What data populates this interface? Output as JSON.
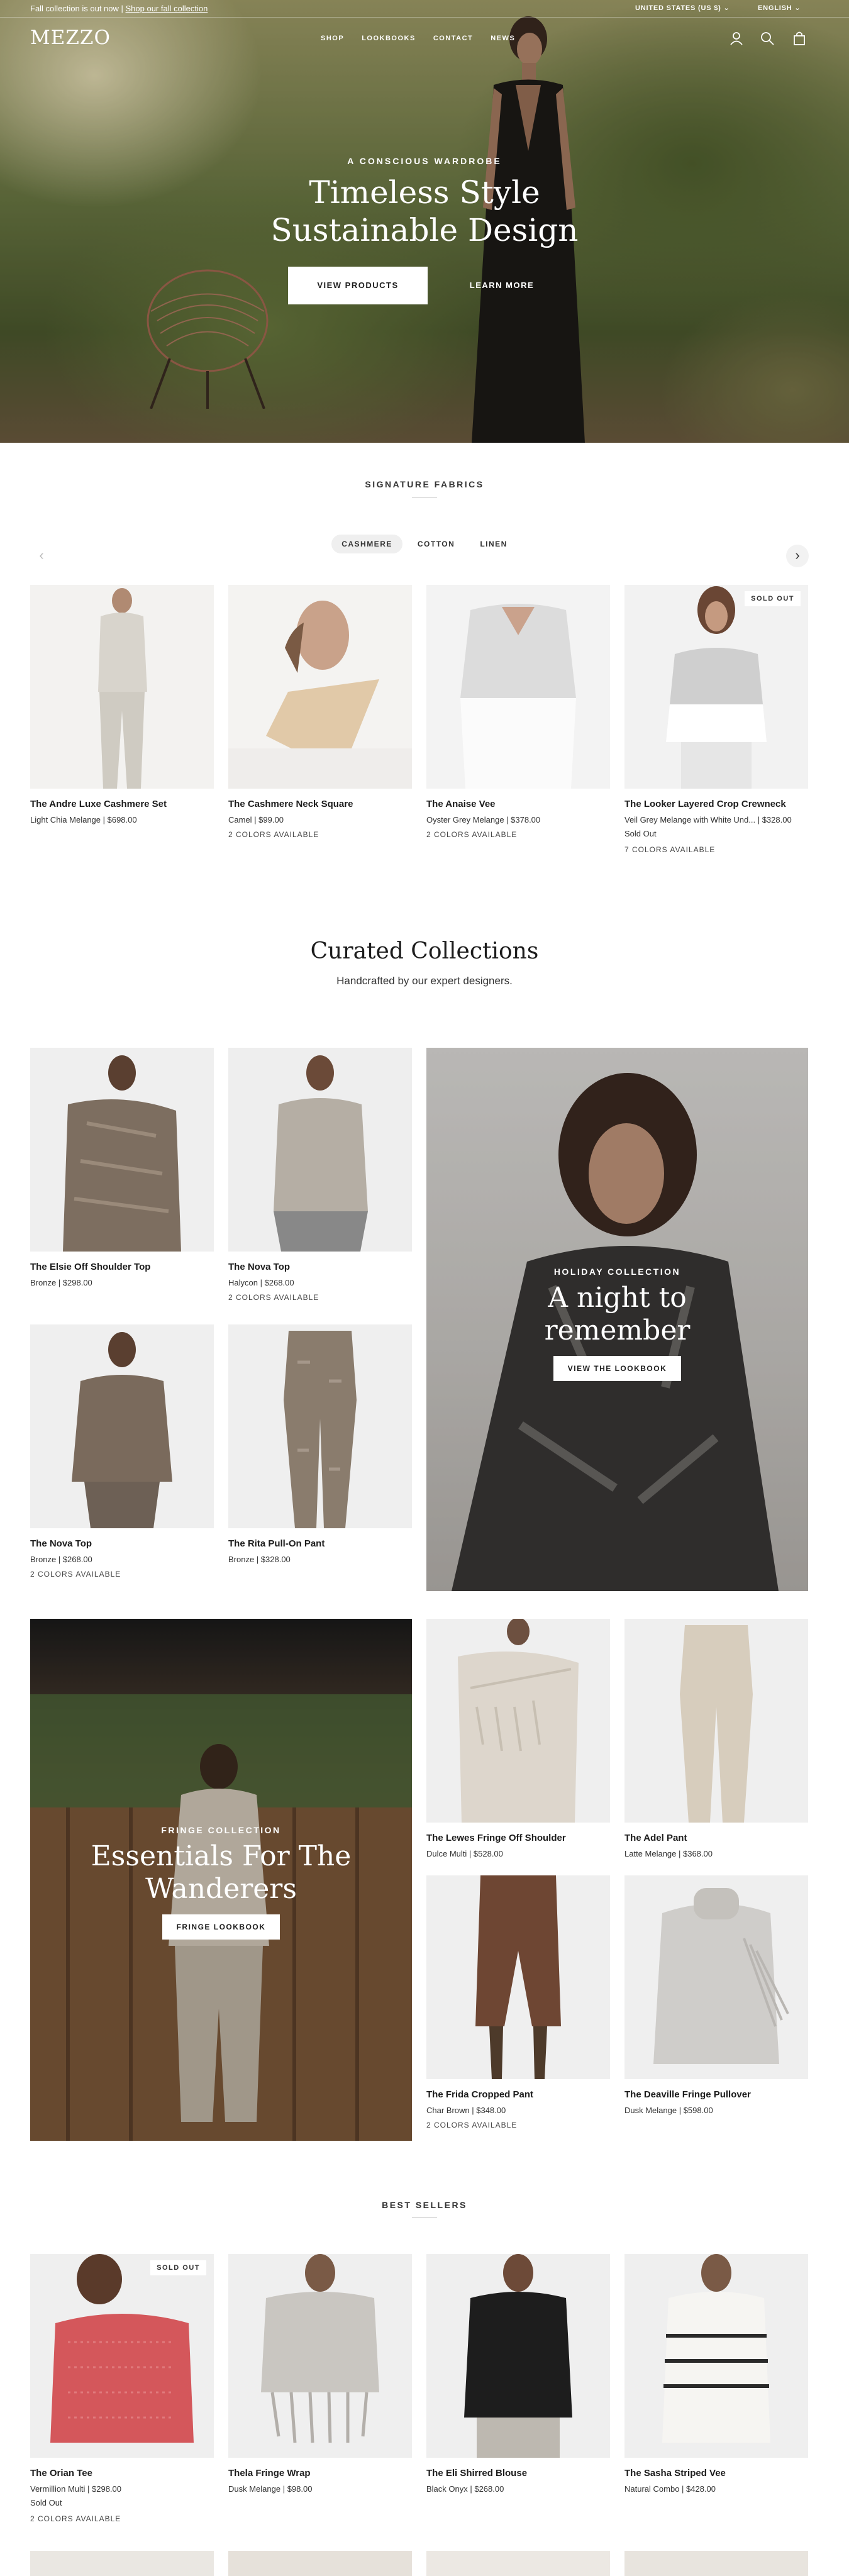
{
  "announcement": {
    "text": "Fall collection is out now | ",
    "link": "Shop our fall collection"
  },
  "selectors": {
    "country": "UNITED STATES (US $)",
    "language": "ENGLISH"
  },
  "brand": {
    "logo": "MEZZO"
  },
  "nav": {
    "items": [
      "SHOP",
      "LOOKBOOKS",
      "CONTACT",
      "NEWS"
    ],
    "icons": [
      "account-icon",
      "search-icon",
      "cart-icon"
    ]
  },
  "hero": {
    "kicker": "A CONSCIOUS WARDROBE",
    "title_line1": "Timeless Style",
    "title_line2": "Sustainable Design",
    "primary_button": "VIEW PRODUCTS",
    "secondary_button": "LEARN MORE"
  },
  "signature": {
    "title": "SIGNATURE FABRICS",
    "tabs": [
      "CASHMERE",
      "COTTON",
      "LINEN"
    ],
    "active_tab": "CASHMERE",
    "products": [
      {
        "name": "The Andre Luxe Cashmere Set",
        "price": "Light Chia Melange | $698.00",
        "colors": "",
        "sold_out": false
      },
      {
        "name": "The Cashmere Neck Square",
        "price": "Camel | $99.00",
        "colors": "2 COLORS AVAILABLE",
        "sold_out": false
      },
      {
        "name": "The Anaise Vee",
        "price": "Oyster Grey Melange | $378.00",
        "colors": "2 COLORS AVAILABLE",
        "sold_out": false
      },
      {
        "name": "The Looker Layered Crop Crewneck",
        "price": "Veil Grey Melange with White Und... | $328.00",
        "status": "Sold Out",
        "colors": "7 COLORS AVAILABLE",
        "sold_out": true,
        "badge": "SOLD OUT"
      }
    ]
  },
  "curated": {
    "title": "Curated Collections",
    "subtitle": "Handcrafted by our expert designers.",
    "products": [
      {
        "name": "The Elsie Off Shoulder Top",
        "price": "Bronze | $298.00",
        "colors": ""
      },
      {
        "name": "The Nova Top",
        "price": "Halycon | $268.00",
        "colors": "2 COLORS AVAILABLE"
      },
      {
        "name": "The Nova Top",
        "price": "Bronze | $268.00",
        "colors": "2 COLORS AVAILABLE"
      },
      {
        "name": "The Rita Pull-On Pant",
        "price": "Bronze | $328.00",
        "colors": ""
      }
    ],
    "holiday": {
      "kicker": "HOLIDAY COLLECTION",
      "title_line1": "A night to",
      "title_line2": "remember",
      "button": "VIEW THE LOOKBOOK"
    },
    "fringe": {
      "kicker": "FRINGE COLLECTION",
      "title_line1": "Essentials For The",
      "title_line2": "Wanderers",
      "button": "FRINGE LOOKBOOK"
    },
    "fringe_products": [
      {
        "name": "The Lewes Fringe Off Shoulder",
        "price": "Dulce Multi | $528.00",
        "colors": ""
      },
      {
        "name": "The Adel Pant",
        "price": "Latte Melange | $368.00",
        "colors": ""
      },
      {
        "name": "The Frida Cropped Pant",
        "price": "Char Brown | $348.00",
        "colors": "2 COLORS AVAILABLE"
      },
      {
        "name": "The Deaville Fringe Pullover",
        "price": "Dusk Melange | $598.00",
        "colors": ""
      }
    ]
  },
  "bestsellers": {
    "title": "BEST SELLERS",
    "products": [
      {
        "name": "The Orian Tee",
        "price": "Vermillion Multi | $298.00",
        "status": "Sold Out",
        "colors": "2 COLORS AVAILABLE",
        "badge": "SOLD OUT"
      },
      {
        "name": "Thela Fringe Wrap",
        "price": "Dusk Melange | $98.00",
        "colors": ""
      },
      {
        "name": "The Eli Shirred Blouse",
        "price": "Black Onyx | $268.00",
        "colors": ""
      },
      {
        "name": "The Sasha Striped Vee",
        "price": "Natural Combo | $428.00",
        "colors": ""
      }
    ]
  },
  "colors": {
    "text": "#1c1c1c",
    "muted": "#444444",
    "tab_active_bg": "#efefef",
    "badge_bg": "#ffffff"
  }
}
